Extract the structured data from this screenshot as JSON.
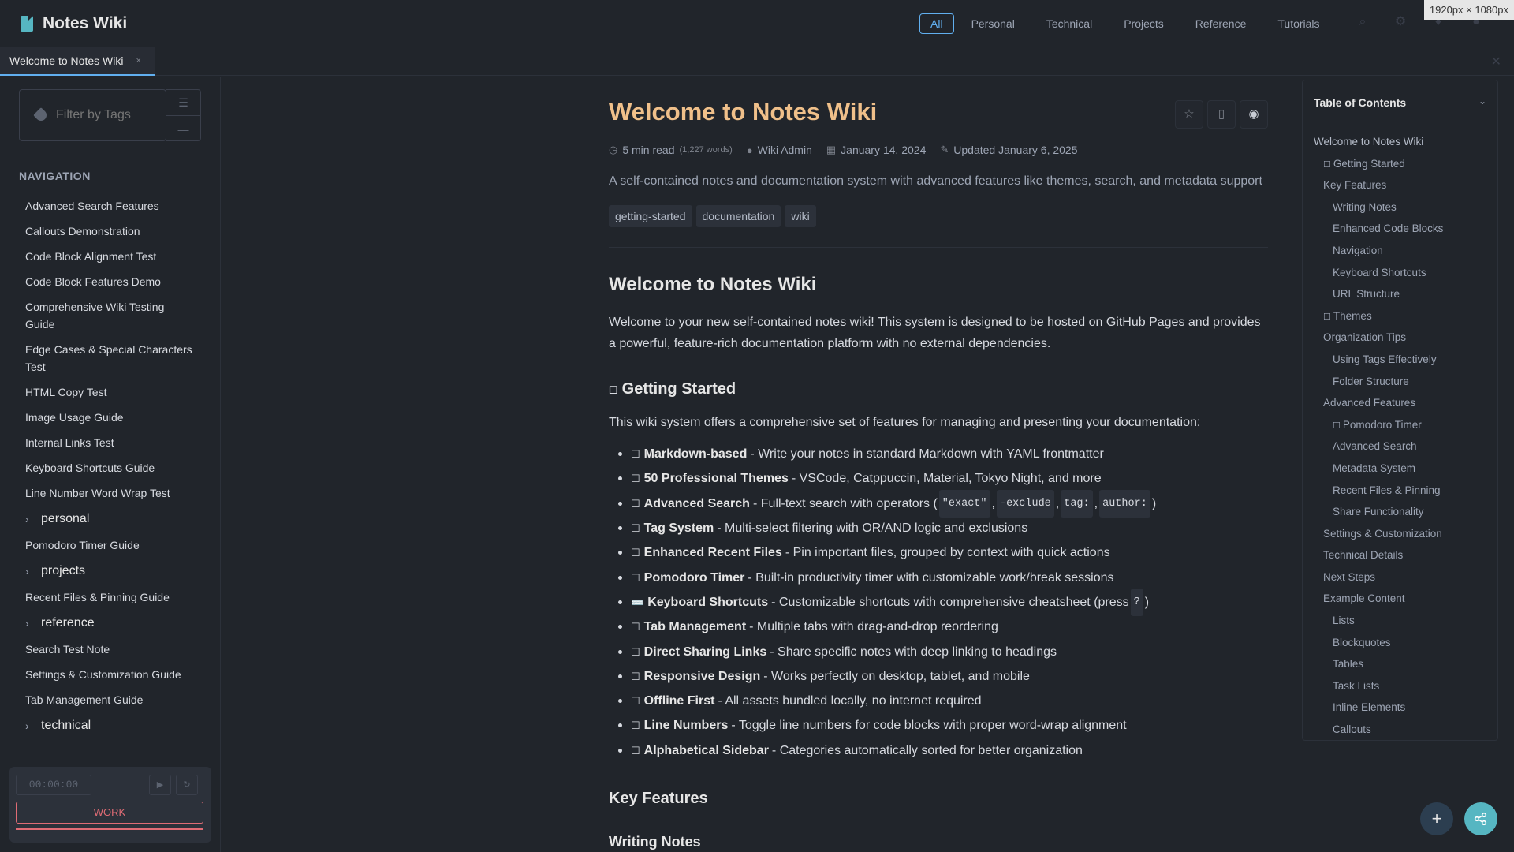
{
  "app": {
    "title": "Notes Wiki"
  },
  "categories": [
    "All",
    "Personal",
    "Technical",
    "Projects",
    "Reference",
    "Tutorials"
  ],
  "header_icons": [
    "search-icon",
    "settings-icon",
    "bookmark-icon",
    "info-icon"
  ],
  "viewport_badge": "1920px × 1080px",
  "tab": {
    "label": "Welcome to Notes Wiki",
    "close": "×"
  },
  "sidebar": {
    "filter_placeholder": "Filter by Tags",
    "filter_buttons": [
      "☰",
      "—"
    ],
    "nav_heading": "NAVIGATION",
    "items": [
      {
        "label": "Advanced Search Features",
        "folder": false
      },
      {
        "label": "Callouts Demonstration",
        "folder": false
      },
      {
        "label": "Code Block Alignment Test",
        "folder": false
      },
      {
        "label": "Code Block Features Demo",
        "folder": false
      },
      {
        "label": "Comprehensive Wiki Testing Guide",
        "folder": false
      },
      {
        "label": "Edge Cases & Special Characters Test",
        "folder": false
      },
      {
        "label": "HTML Copy Test",
        "folder": false
      },
      {
        "label": "Image Usage Guide",
        "folder": false
      },
      {
        "label": "Internal Links Test",
        "folder": false
      },
      {
        "label": "Keyboard Shortcuts Guide",
        "folder": false
      },
      {
        "label": "Line Number Word Wrap Test",
        "folder": false
      },
      {
        "label": "personal",
        "folder": true
      },
      {
        "label": "Pomodoro Timer Guide",
        "folder": false
      },
      {
        "label": "projects",
        "folder": true
      },
      {
        "label": "Recent Files & Pinning Guide",
        "folder": false
      },
      {
        "label": "reference",
        "folder": true
      },
      {
        "label": "Search Test Note",
        "folder": false
      },
      {
        "label": "Settings & Customization Guide",
        "folder": false
      },
      {
        "label": "Tab Management Guide",
        "folder": false
      },
      {
        "label": "technical",
        "folder": true
      }
    ],
    "pomodoro": {
      "time": "00:00:00",
      "play": "▶",
      "reset": "↻",
      "mode": "WORK",
      "progress": 1.0
    }
  },
  "article": {
    "title": "Welcome to Notes Wiki",
    "read_time": "5 min read",
    "words": "(1,227 words)",
    "author": "Wiki Admin",
    "date": "January 14, 2024",
    "updated": "Updated January 6, 2025",
    "description": "A self-contained notes and documentation system with advanced features like themes, search, and metadata support",
    "tags": [
      "getting-started",
      "documentation",
      "wiki"
    ],
    "h1": "Welcome to Notes Wiki",
    "intro": "Welcome to your new self-contained notes wiki! This system is designed to be hosted on GitHub Pages and provides a powerful, feature-rich documentation platform with no external dependencies.",
    "getting_started": "Getting Started",
    "getting_started_text": "This wiki system offers a comprehensive set of features for managing and presenting your documentation:",
    "features": [
      {
        "name": "Markdown-based",
        "desc": "- Write your notes in standard Markdown with YAML frontmatter"
      },
      {
        "name": "50 Professional Themes",
        "desc": "- VSCode, Catppuccin, Material, Tokyo Night, and more"
      },
      {
        "name": "Advanced Search",
        "desc": "- Full-text search with operators (",
        "codes": [
          "\"exact\"",
          "-exclude",
          "tag:",
          "author:"
        ],
        "tail": ")"
      },
      {
        "name": "Tag System",
        "desc": "- Multi-select filtering with OR/AND logic and exclusions"
      },
      {
        "name": "Enhanced Recent Files",
        "desc": "- Pin important files, grouped by context with quick actions"
      },
      {
        "name": "Pomodoro Timer",
        "desc": "- Built-in productivity timer with customizable work/break sessions"
      },
      {
        "name": "Keyboard Shortcuts",
        "desc": "- Customizable shortcuts with comprehensive cheatsheet (press",
        "codes": [
          "?"
        ],
        "tail": ")",
        "emoji": "⌨️"
      },
      {
        "name": "Tab Management",
        "desc": "- Multiple tabs with drag-and-drop reordering"
      },
      {
        "name": "Direct Sharing Links",
        "desc": "- Share specific notes with deep linking to headings"
      },
      {
        "name": "Responsive Design",
        "desc": "- Works perfectly on desktop, tablet, and mobile"
      },
      {
        "name": "Offline First",
        "desc": "- All assets bundled locally, no internet required"
      },
      {
        "name": "Line Numbers",
        "desc": "- Toggle line numbers for code blocks with proper word-wrap alignment"
      },
      {
        "name": "Alphabetical Sidebar",
        "desc": "- Categories automatically sorted for better organization"
      }
    ],
    "key_features": "Key Features",
    "writing_notes": "Writing Notes"
  },
  "toc": {
    "title": "Table of Contents",
    "items": [
      {
        "label": "Welcome to Notes Wiki",
        "level": 1
      },
      {
        "label": "Getting Started",
        "level": 2,
        "box": true
      },
      {
        "label": "Key Features",
        "level": 2
      },
      {
        "label": "Writing Notes",
        "level": 3
      },
      {
        "label": "Enhanced Code Blocks",
        "level": 3
      },
      {
        "label": "Navigation",
        "level": 3
      },
      {
        "label": "Keyboard Shortcuts",
        "level": 3
      },
      {
        "label": "URL Structure",
        "level": 3
      },
      {
        "label": "Themes",
        "level": 2,
        "box": true
      },
      {
        "label": "Organization Tips",
        "level": 2
      },
      {
        "label": "Using Tags Effectively",
        "level": 3
      },
      {
        "label": "Folder Structure",
        "level": 3
      },
      {
        "label": "Advanced Features",
        "level": 2
      },
      {
        "label": "Pomodoro Timer",
        "level": 3,
        "box": true
      },
      {
        "label": "Advanced Search",
        "level": 3
      },
      {
        "label": "Metadata System",
        "level": 3
      },
      {
        "label": "Recent Files & Pinning",
        "level": 3
      },
      {
        "label": "Share Functionality",
        "level": 3
      },
      {
        "label": "Settings & Customization",
        "level": 2
      },
      {
        "label": "Technical Details",
        "level": 2
      },
      {
        "label": "Next Steps",
        "level": 2
      },
      {
        "label": "Example Content",
        "level": 2
      },
      {
        "label": "Lists",
        "level": 3
      },
      {
        "label": "Blockquotes",
        "level": 3
      },
      {
        "label": "Tables",
        "level": 3
      },
      {
        "label": "Task Lists",
        "level": 3
      },
      {
        "label": "Inline Elements",
        "level": 3
      },
      {
        "label": "Callouts",
        "level": 3
      }
    ]
  },
  "fab": {
    "add": "+",
    "share": "share-icon"
  },
  "colors": {
    "accent": "#61afef",
    "title": "#f0c08a",
    "work": "#e06c75",
    "share": "#56b6c2"
  }
}
